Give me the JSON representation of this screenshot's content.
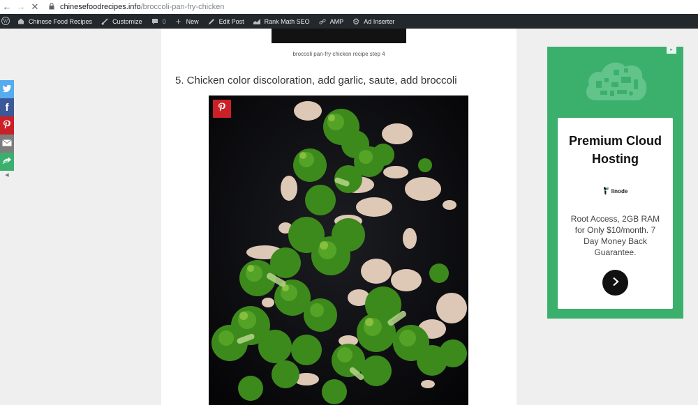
{
  "browser": {
    "back_icon": "arrow-left-icon",
    "forward_icon": "arrow-right-icon",
    "stop_icon": "close-icon",
    "url_host": "chinesefoodrecipes.info",
    "url_path": "/broccoli-pan-fry-chicken"
  },
  "adminbar": {
    "items": [
      {
        "label": "Chinese Food Recipes",
        "icon": "home-icon"
      },
      {
        "label": "Customize",
        "icon": "brush-icon"
      },
      {
        "label": "0",
        "icon": "comment-icon"
      },
      {
        "label": "New",
        "icon": "plus-icon"
      },
      {
        "label": "Edit Post",
        "icon": "pencil-icon"
      },
      {
        "label": "Rank Math SEO",
        "icon": "rank-math-icon"
      },
      {
        "label": "AMP",
        "icon": "link-icon"
      },
      {
        "label": "Ad Inserter",
        "icon": "gear-icon"
      }
    ]
  },
  "article": {
    "caption": "broccoli pan-fry chicken recipe step 4",
    "step_heading": "5. Chicken color discoloration, add garlic, saute, add broccoli"
  },
  "share": {
    "buttons": [
      {
        "name": "twitter",
        "glyph": "t",
        "color": "#55acee"
      },
      {
        "name": "facebook",
        "glyph": "f",
        "color": "#3b5998"
      },
      {
        "name": "pinterest",
        "glyph": "P",
        "color": "#cb2027"
      },
      {
        "name": "email",
        "glyph": "✉",
        "color": "#7d7d7d"
      },
      {
        "name": "more",
        "glyph": "+",
        "color": "#3bb06d"
      }
    ]
  },
  "ad": {
    "headline": "Premium Cloud Hosting",
    "brand": "linode",
    "body": "Root Access, 2GB RAM for Only $10/month. 7 Day Money Back Guarantee.",
    "cta_icon": "chevron-right-icon",
    "colors": {
      "background": "#3bb06d"
    }
  }
}
